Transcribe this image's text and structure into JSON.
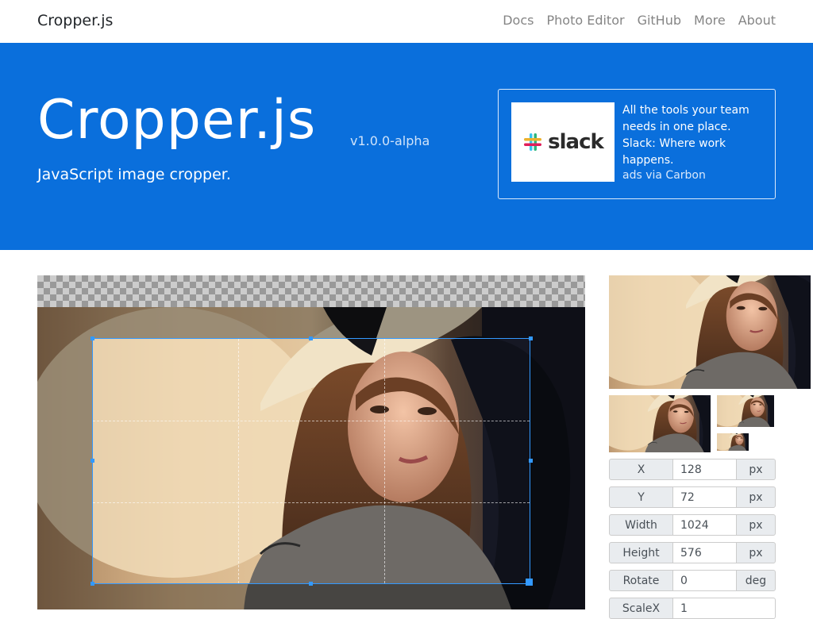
{
  "navbar": {
    "brand": "Cropper.js",
    "links": [
      "Docs",
      "Photo Editor",
      "GitHub",
      "More",
      "About"
    ]
  },
  "hero": {
    "title": "Cropper.js",
    "version": "v1.0.0-alpha",
    "subtitle": "JavaScript image cropper."
  },
  "ad": {
    "logo_text": "slack",
    "text": "All the tools your team needs in one place. Slack: Where work happens.",
    "via": "ads via Carbon"
  },
  "fields": [
    {
      "label": "X",
      "value": "128",
      "unit": "px"
    },
    {
      "label": "Y",
      "value": "72",
      "unit": "px"
    },
    {
      "label": "Width",
      "value": "1024",
      "unit": "px"
    },
    {
      "label": "Height",
      "value": "576",
      "unit": "px"
    },
    {
      "label": "Rotate",
      "value": "0",
      "unit": "deg"
    },
    {
      "label": "ScaleX",
      "value": "1",
      "unit": ""
    }
  ],
  "colors": {
    "primary": "#0a6fdc",
    "crop_accent": "#3399ff"
  }
}
